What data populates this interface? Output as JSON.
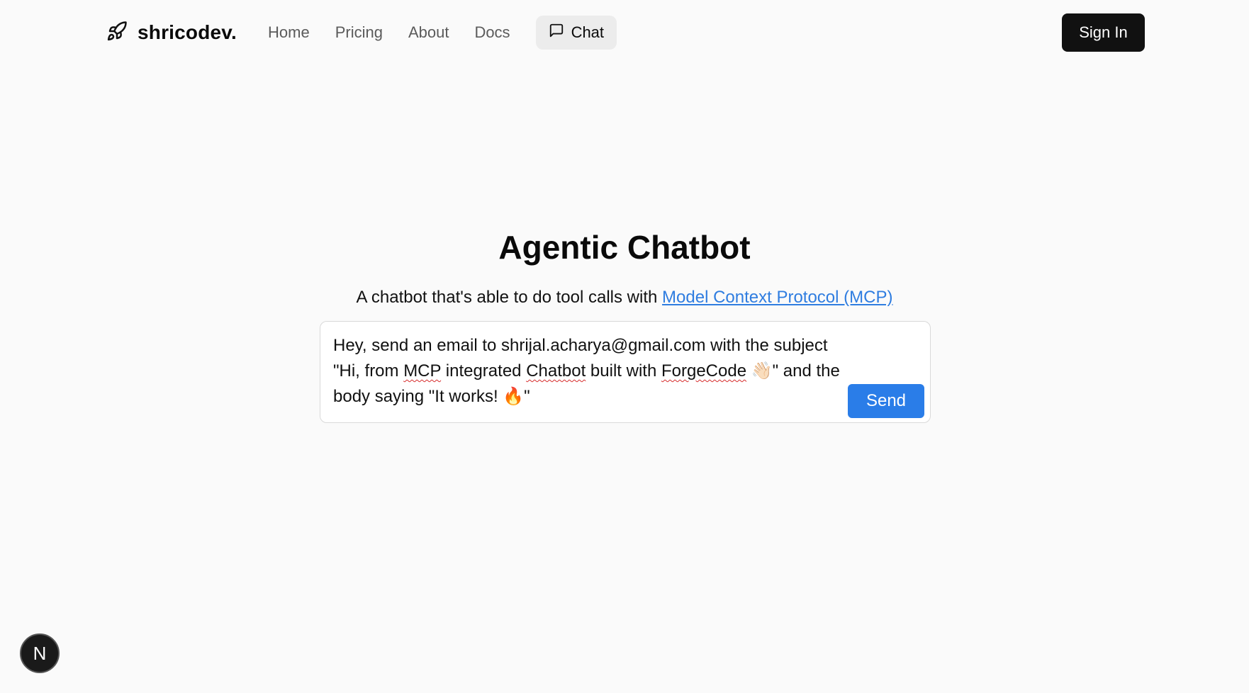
{
  "header": {
    "brand": "shricodev.",
    "nav": [
      "Home",
      "Pricing",
      "About",
      "Docs"
    ],
    "chat_label": "Chat",
    "signin_label": "Sign In"
  },
  "main": {
    "title": "Agentic Chatbot",
    "subtitle_prefix": "A chatbot that's able to do tool calls with ",
    "subtitle_link": "Model Context Protocol (MCP)",
    "message_parts": [
      "Hey, send an email to shrijal.acharya@gmail.com with the subject \"Hi, from ",
      "MCP",
      " integrated ",
      "Chatbot",
      " built with ",
      "ForgeCode",
      " 👋🏻\" and the body saying \"It works! 🔥\""
    ],
    "send_label": "Send"
  },
  "badge": {
    "letter": "N"
  },
  "colors": {
    "background": "#fafafa",
    "link": "#2f7de0",
    "send_button": "#2a7de8",
    "signin_button": "#111111",
    "chat_tab_bg": "#ececec"
  },
  "icons": {
    "brand": "rocket-icon",
    "chat": "message-square-icon"
  }
}
